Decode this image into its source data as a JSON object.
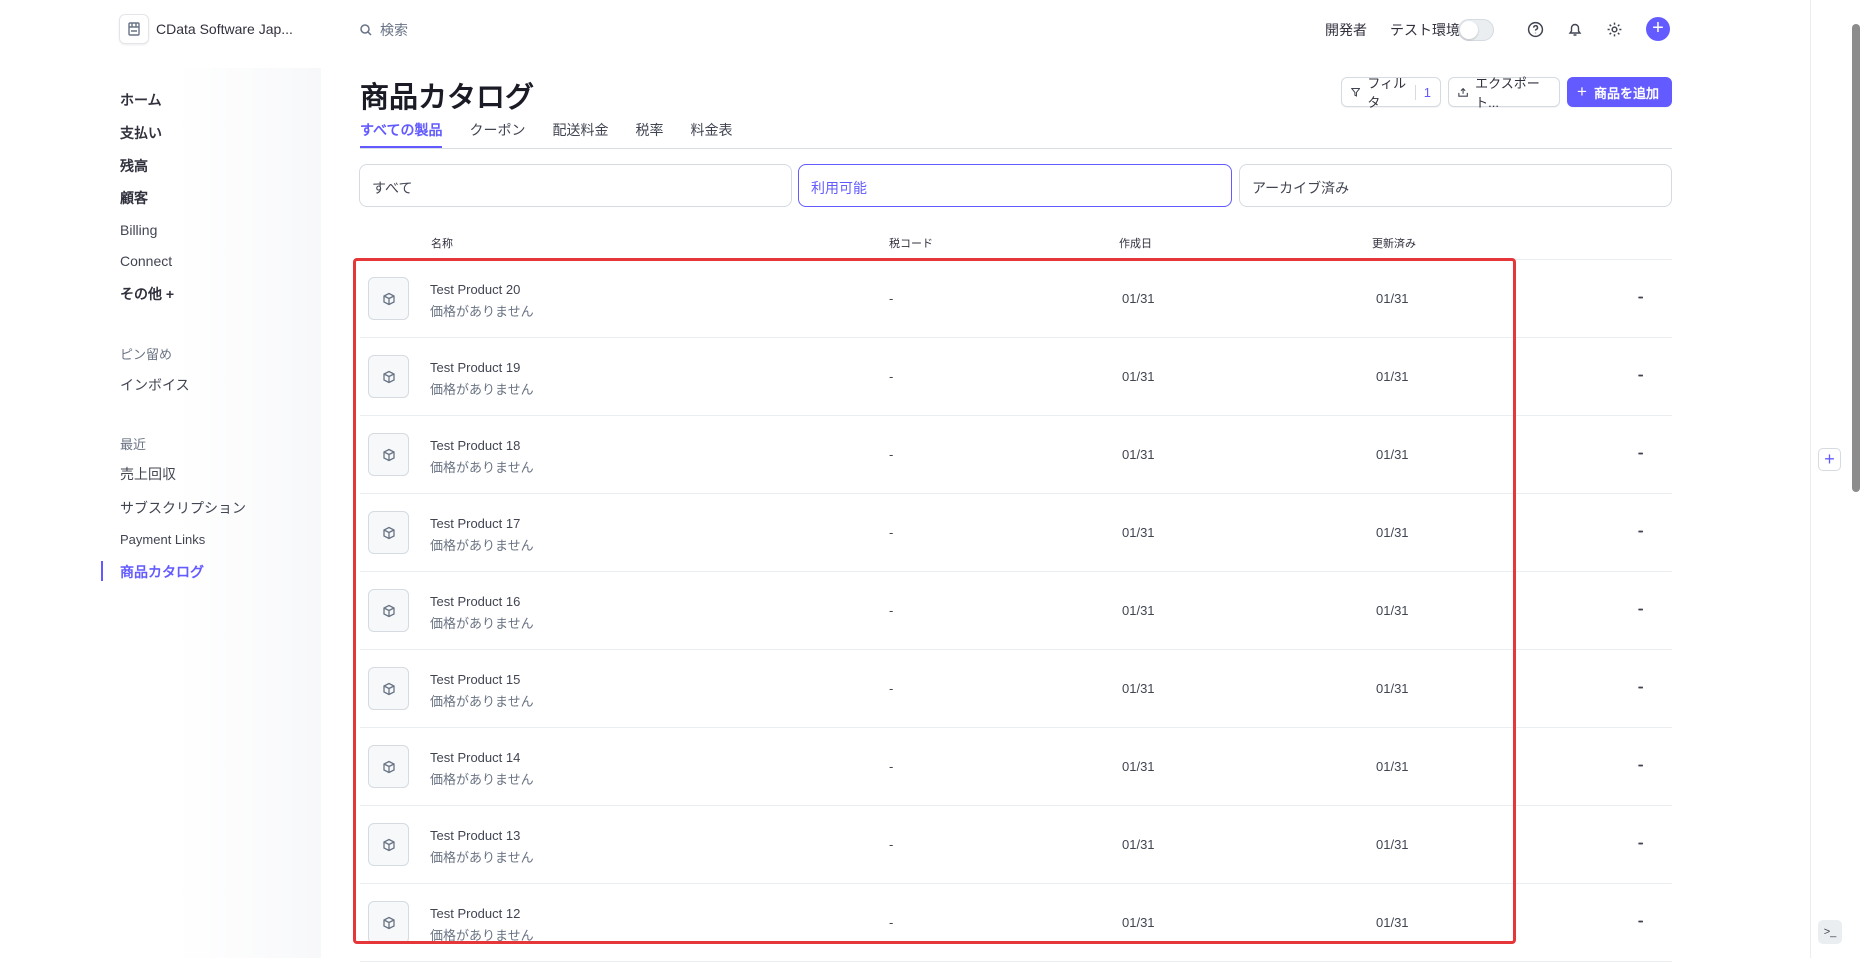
{
  "header": {
    "account_name": "CData Software Jap...",
    "search_placeholder": "検索",
    "developer": "開発者",
    "test_env": "テスト環境"
  },
  "sidebar": {
    "main": [
      {
        "label": "ホーム"
      },
      {
        "label": "支払い"
      },
      {
        "label": "残高"
      },
      {
        "label": "顧客"
      },
      {
        "label": "Billing"
      },
      {
        "label": "Connect"
      },
      {
        "label": "その他 +"
      }
    ],
    "pinned_heading": "ピン留め",
    "pinned": [
      {
        "label": "インボイス"
      }
    ],
    "recent_heading": "最近",
    "recent": [
      {
        "label": "売上回収"
      },
      {
        "label": "サブスクリプション"
      },
      {
        "label": "Payment Links"
      },
      {
        "label": "商品カタログ"
      }
    ]
  },
  "page": {
    "title": "商品カタログ",
    "filter_label": "フィルタ",
    "filter_count": "1",
    "export_label": "エクスポート...",
    "add_label": "商品を追加"
  },
  "tabs": [
    {
      "label": "すべての製品"
    },
    {
      "label": "クーポン"
    },
    {
      "label": "配送料金"
    },
    {
      "label": "税率"
    },
    {
      "label": "料金表"
    }
  ],
  "segments": [
    {
      "label": "すべて"
    },
    {
      "label": "利用可能"
    },
    {
      "label": "アーカイブ済み"
    }
  ],
  "table": {
    "headers": {
      "name": "名称",
      "tax": "税コード",
      "created": "作成日",
      "updated": "更新済み"
    },
    "rows": [
      {
        "name": "Test Product 20",
        "sub": "価格がありません",
        "tax": "-",
        "created": "01/31",
        "updated": "01/31"
      },
      {
        "name": "Test Product 19",
        "sub": "価格がありません",
        "tax": "-",
        "created": "01/31",
        "updated": "01/31"
      },
      {
        "name": "Test Product 18",
        "sub": "価格がありません",
        "tax": "-",
        "created": "01/31",
        "updated": "01/31"
      },
      {
        "name": "Test Product 17",
        "sub": "価格がありません",
        "tax": "-",
        "created": "01/31",
        "updated": "01/31"
      },
      {
        "name": "Test Product 16",
        "sub": "価格がありません",
        "tax": "-",
        "created": "01/31",
        "updated": "01/31"
      },
      {
        "name": "Test Product 15",
        "sub": "価格がありません",
        "tax": "-",
        "created": "01/31",
        "updated": "01/31"
      },
      {
        "name": "Test Product 14",
        "sub": "価格がありません",
        "tax": "-",
        "created": "01/31",
        "updated": "01/31"
      },
      {
        "name": "Test Product 13",
        "sub": "価格がありません",
        "tax": "-",
        "created": "01/31",
        "updated": "01/31"
      },
      {
        "name": "Test Product 12",
        "sub": "価格がありません",
        "tax": "-",
        "created": "01/31",
        "updated": "01/31"
      }
    ]
  },
  "colors": {
    "accent": "#635bff",
    "highlight": "#e5373a"
  }
}
